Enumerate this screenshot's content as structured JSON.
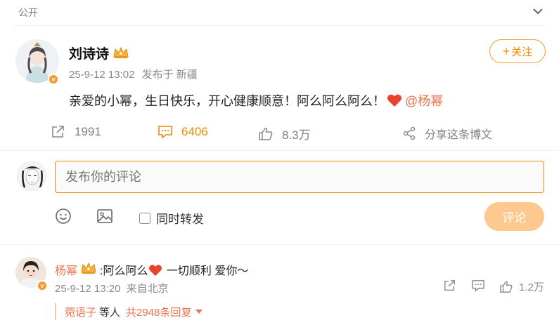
{
  "header": {
    "visibility": "公开",
    "collapse_icon": "chevron-down-icon"
  },
  "post": {
    "author": "刘诗诗",
    "verified": "v",
    "timestamp": "25-9-12 13:02",
    "location": "发布于 新疆",
    "follow_label": "关注",
    "follow_plus": "+",
    "text_main": "亲爱的小幂，生日快乐，开心健康顺意！阿么阿么阿么！",
    "mention": "@杨幂"
  },
  "actions": {
    "repost_count": "1991",
    "comment_count": "6406",
    "like_count": "8.3万",
    "share_label": "分享这条博文"
  },
  "composer": {
    "placeholder": "发布你的评论",
    "repost_label": "同时转发",
    "submit_label": "评论"
  },
  "reply": {
    "author": "杨幂",
    "text_before": ":阿么阿么",
    "text_after": " 一切顺利 爱你～",
    "timestamp": "25-9-12 13:20",
    "location": "来自北京",
    "like_count": "1.2万",
    "sub_name": "菀语子",
    "sub_etc": "等人",
    "sub_total": "共2948条回复"
  },
  "colors": {
    "accent": "#f08a00",
    "link": "#eb7350",
    "submit_disabled": "#fdc98f",
    "heart": "#e8412c"
  }
}
